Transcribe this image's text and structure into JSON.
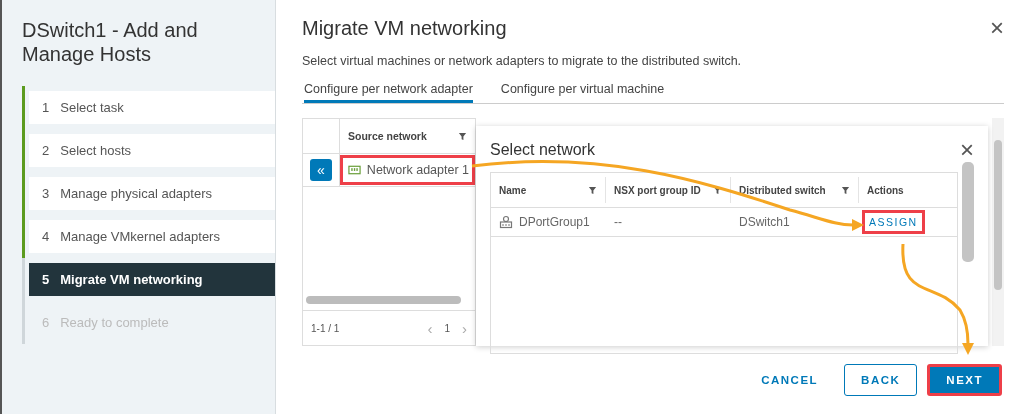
{
  "wizard": {
    "title": "DSwitch1 - Add and Manage Hosts",
    "steps": [
      {
        "number": "1",
        "label": "Select task",
        "completed": true,
        "disabled": false,
        "selected": false
      },
      {
        "number": "2",
        "label": "Select hosts",
        "completed": true,
        "disabled": false,
        "selected": false
      },
      {
        "number": "3",
        "label": "Manage physical adapters",
        "completed": true,
        "disabled": false,
        "selected": false
      },
      {
        "number": "4",
        "label": "Manage VMkernel adapters",
        "completed": true,
        "disabled": false,
        "selected": false
      },
      {
        "number": "5",
        "label": "Migrate VM networking",
        "completed": false,
        "disabled": false,
        "selected": true
      },
      {
        "number": "6",
        "label": "Ready to complete",
        "completed": false,
        "disabled": true,
        "selected": false
      }
    ]
  },
  "page": {
    "title": "Migrate VM networking",
    "close": "×",
    "description": "Select virtual machines or network adapters to migrate to the distributed switch.",
    "tabs": [
      {
        "label": "Configure per network adapter",
        "selected": true
      },
      {
        "label": "Configure per virtual machine",
        "selected": false
      }
    ]
  },
  "adapter_table": {
    "collapse": "«",
    "columns": [
      {
        "label": "Source network"
      }
    ],
    "rows": [
      {
        "name": "Network adapter 1",
        "highlighted": true
      }
    ],
    "footer": {
      "count": "1-1 / 1",
      "prev": "‹",
      "page": "1",
      "next": "›"
    }
  },
  "dialog": {
    "title": "Select network",
    "close": "×",
    "columns": [
      {
        "label": "Name"
      },
      {
        "label": "NSX port group ID"
      },
      {
        "label": "Distributed switch"
      },
      {
        "label": "Actions"
      }
    ],
    "rows": [
      {
        "name": "DPortGroup1",
        "nsx_id": "--",
        "switch": "DSwitch1",
        "action": "ASSIGN",
        "highlighted": true
      }
    ]
  },
  "buttons": [
    {
      "label": "CANCEL",
      "kind": "link",
      "highlighted": false
    },
    {
      "label": "BACK",
      "kind": "outline",
      "highlighted": false
    },
    {
      "label": "NEXT",
      "kind": "primary",
      "highlighted": true
    }
  ]
}
